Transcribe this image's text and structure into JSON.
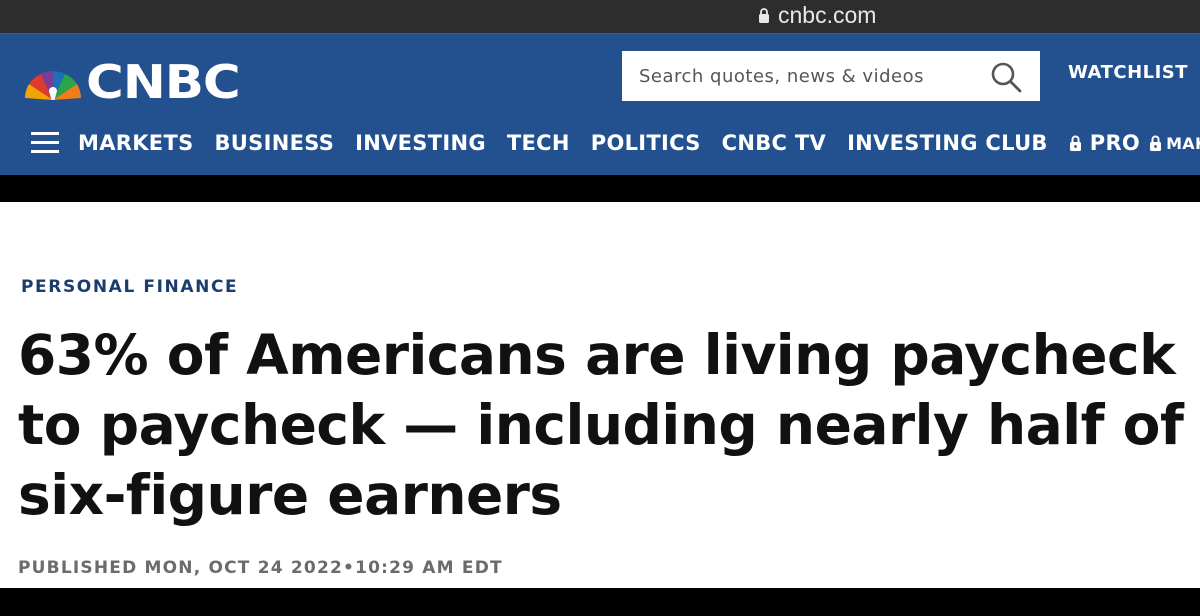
{
  "browser": {
    "url": "cnbc.com"
  },
  "header": {
    "logo_text": "CNBC",
    "search_placeholder": "Search quotes, news & videos",
    "watchlist_label": "WATCHLIST"
  },
  "nav": {
    "items": [
      {
        "label": "MARKETS"
      },
      {
        "label": "BUSINESS"
      },
      {
        "label": "INVESTING"
      },
      {
        "label": "TECH"
      },
      {
        "label": "POLITICS"
      },
      {
        "label": "CNBC TV"
      },
      {
        "label": "INVESTING CLUB"
      },
      {
        "label": "PRO"
      },
      {
        "label": "MAKE"
      }
    ]
  },
  "article": {
    "section": "PERSONAL FINANCE",
    "headline": "63% of Americans are living paycheck to paycheck — including nearly half of six-figure earners",
    "published": "PUBLISHED MON, OCT 24 2022•10:29 AM EDT"
  },
  "colors": {
    "header_bg": "#23508e",
    "section_label": "#1b3d6e",
    "published_text": "#6b6b6b"
  }
}
